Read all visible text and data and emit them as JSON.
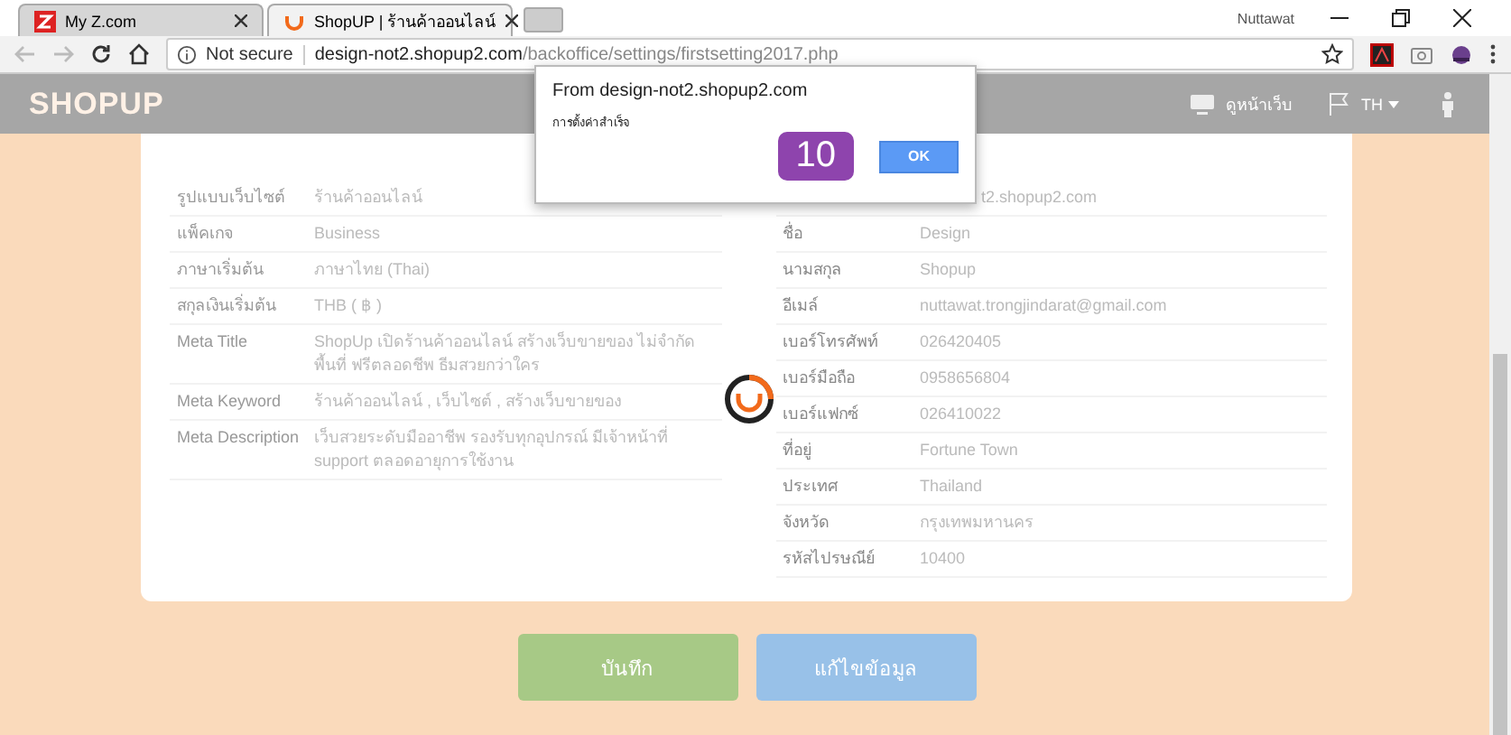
{
  "browser": {
    "tabs": [
      {
        "title": "My Z.com",
        "selected": false
      },
      {
        "title": "ShopUP | ร้านค้าออนไลน์",
        "selected": true
      }
    ],
    "user_name": "Nuttawat",
    "security": "Not secure",
    "host": "design-not2.shopup2.com",
    "path": "/backoffice/settings/firstsetting2017.php"
  },
  "header": {
    "logo": "SHOPUP",
    "view_site": "ดูหน้าเว็บ",
    "language": "TH"
  },
  "left_fields": [
    {
      "label": "รูปแบบเว็บไซต์",
      "value": "ร้านค้าออนไลน์"
    },
    {
      "label": "แพ็คเกจ",
      "value": "Business"
    },
    {
      "label": "ภาษาเริ่มต้น",
      "value": "ภาษาไทย (Thai)"
    },
    {
      "label": "สกุลเงินเริ่มต้น",
      "value": "THB ( ฿ )"
    },
    {
      "label": "Meta Title",
      "value": "ShopUp เปิดร้านค้าออนไลน์ สร้างเว็บขายของ ไม่จำกัดพื้นที่ ฟรีตลอดชีพ ธีมสวยกว่าใคร"
    },
    {
      "label": "Meta Keyword",
      "value": "ร้านค้าออนไลน์ , เว็บไซต์ , สร้างเว็บขายของ"
    },
    {
      "label": "Meta Description",
      "value": "เว็บสวยระดับมืออาชีพ รองรับทุกอุปกรณ์ มีเจ้าหน้าที่ support ตลอดอายุการใช้งาน"
    }
  ],
  "right_partial_value": "t2.shopup2.com",
  "right_fields": [
    {
      "label": "ชื่อ",
      "value": "Design"
    },
    {
      "label": "นามสกุล",
      "value": "Shopup"
    },
    {
      "label": "อีเมล์",
      "value": "nuttawat.trongjindarat@gmail.com"
    },
    {
      "label": "เบอร์โทรศัพท์",
      "value": "026420405"
    },
    {
      "label": "เบอร์มือถือ",
      "value": "0958656804"
    },
    {
      "label": "เบอร์แฟกซ์",
      "value": "026410022"
    },
    {
      "label": "ที่อยู่",
      "value": "Fortune Town"
    },
    {
      "label": "ประเทศ",
      "value": "Thailand"
    },
    {
      "label": "จังหวัด",
      "value": "กรุงเทพมหานคร"
    },
    {
      "label": "รหัสไปรษณีย์",
      "value": "10400"
    }
  ],
  "buttons": [
    {
      "label": "บันทึก",
      "kind": "save"
    },
    {
      "label": "แก้ไขข้อมูล",
      "kind": "edit"
    }
  ],
  "dialog": {
    "origin": "From design-not2.shopup2.com",
    "message": "การตั้งค่าสำเร็จ",
    "button": "OK"
  },
  "step_badge": "10"
}
